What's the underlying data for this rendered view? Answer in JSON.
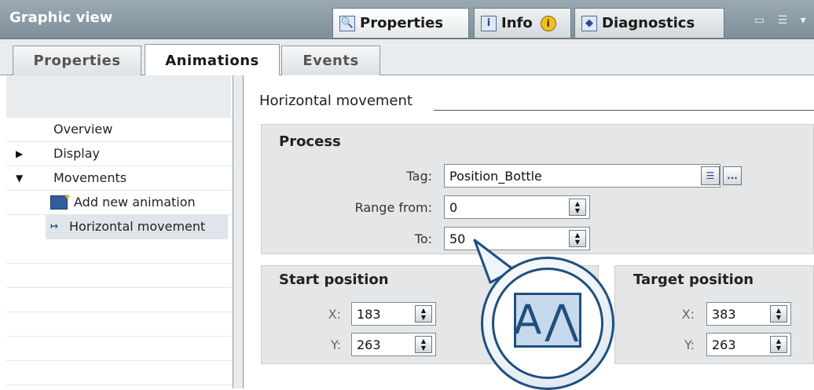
{
  "header": {
    "title": "Graphic view",
    "tabs": [
      {
        "label": "Properties",
        "icon": "properties-icon"
      },
      {
        "label": "Info",
        "icon": "info-icon"
      },
      {
        "label": "Diagnostics",
        "icon": "diagnostics-icon"
      }
    ]
  },
  "subtabs": [
    {
      "label": "Properties"
    },
    {
      "label": "Animations"
    },
    {
      "label": "Events"
    }
  ],
  "tree": {
    "items": [
      {
        "label": "Overview"
      },
      {
        "label": "Display"
      },
      {
        "label": "Movements"
      },
      {
        "label": "Add new animation"
      },
      {
        "label": "Horizontal movement"
      }
    ]
  },
  "section": {
    "title": "Horizontal movement"
  },
  "process": {
    "title": "Process",
    "tag_label": "Tag:",
    "tag_value": "Position_Bottle",
    "tag_button": "...",
    "range_from_label": "Range from:",
    "range_from_value": "0",
    "to_label": "To:",
    "to_value": "50"
  },
  "start_position": {
    "title": "Start position",
    "x_label": "X:",
    "x_value": "183",
    "y_label": "Y:",
    "y_value": "263"
  },
  "target_position": {
    "title": "Target position",
    "x_label": "X:",
    "x_value": "383",
    "y_label": "Y:",
    "y_value": "263"
  },
  "colors": {
    "accent": "#1f4f7f",
    "header": "#8a9aa4",
    "panel": "#e4e6e8"
  }
}
